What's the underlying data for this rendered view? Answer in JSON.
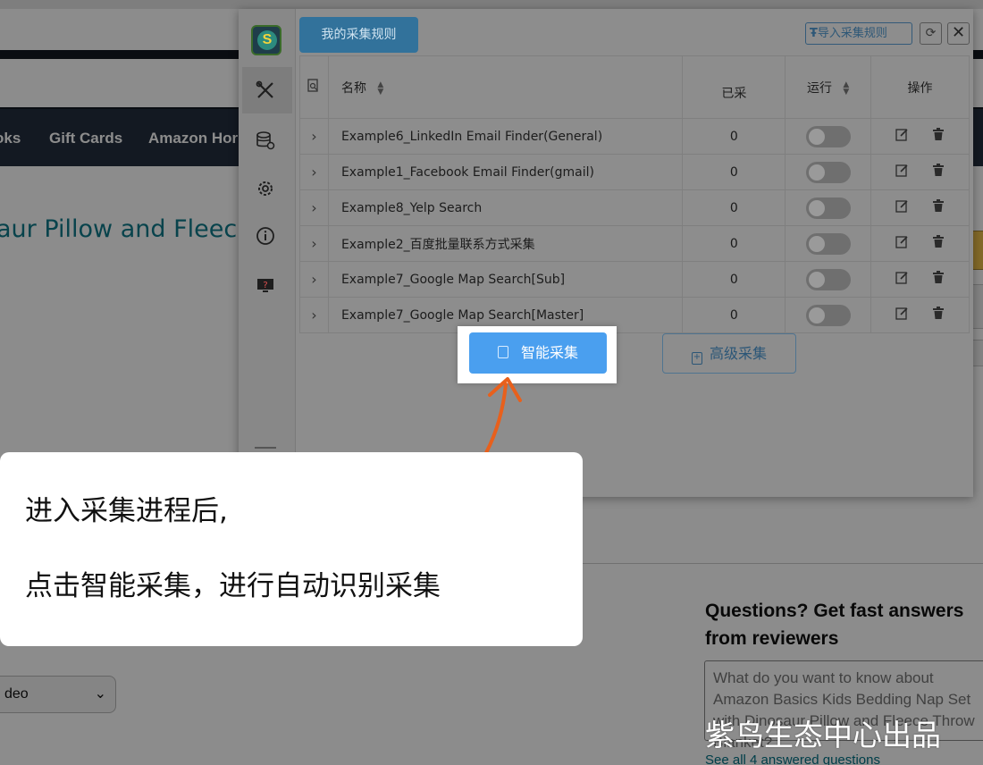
{
  "background_page": {
    "nav_items": [
      "oks",
      "Gift Cards",
      "Amazon Hor"
    ],
    "product_title_fragment": "aur Pillow and Fleec",
    "dropdown_value": "deo",
    "questions_title": "Questions? Get fast answers from reviewers",
    "questions_placeholder": "What do you want to know about Amazon Basics Kids Bedding Nap Set with Dinosaur Pillow and Fleece Throw Blanket?",
    "see_all": "See all 4 answered questions"
  },
  "popup": {
    "logo_letter": "S",
    "tab_label": "我的采集规则",
    "import_label": "导入采集规则",
    "refresh_glyph": "⟳",
    "close_glyph": "✕",
    "sidebar_icons": [
      "tools-icon",
      "database-settings-icon",
      "gear-icon",
      "info-icon",
      "help-monitor-icon"
    ],
    "table": {
      "headers": {
        "name": "名称",
        "count": "已采",
        "run": "运行",
        "ops": "操作"
      },
      "rows": [
        {
          "name": "Example6_LinkedIn Email Finder(General)",
          "count": "0",
          "running": false
        },
        {
          "name": "Example1_Facebook Email Finder(gmail)",
          "count": "0",
          "running": false
        },
        {
          "name": "Example8_Yelp Search",
          "count": "0",
          "running": false
        },
        {
          "name": "Example2_百度批量联系方式采集",
          "count": "0",
          "running": false
        },
        {
          "name": "Example7_Google Map Search[Sub]",
          "count": "0",
          "running": false
        },
        {
          "name": "Example7_Google Map Search[Master]",
          "count": "0",
          "running": false
        }
      ]
    },
    "smart_button": "智能采集",
    "advanced_button": "高级采集"
  },
  "callout": {
    "line1": "进入采集进程后,",
    "line2": "点击智能采集，进行自动识别采集"
  },
  "watermark": "紫鸟生态中心出品",
  "colors": {
    "smart_button": "#4a9fef",
    "tab_active": "#32729b",
    "arrow": "#e8601c"
  }
}
